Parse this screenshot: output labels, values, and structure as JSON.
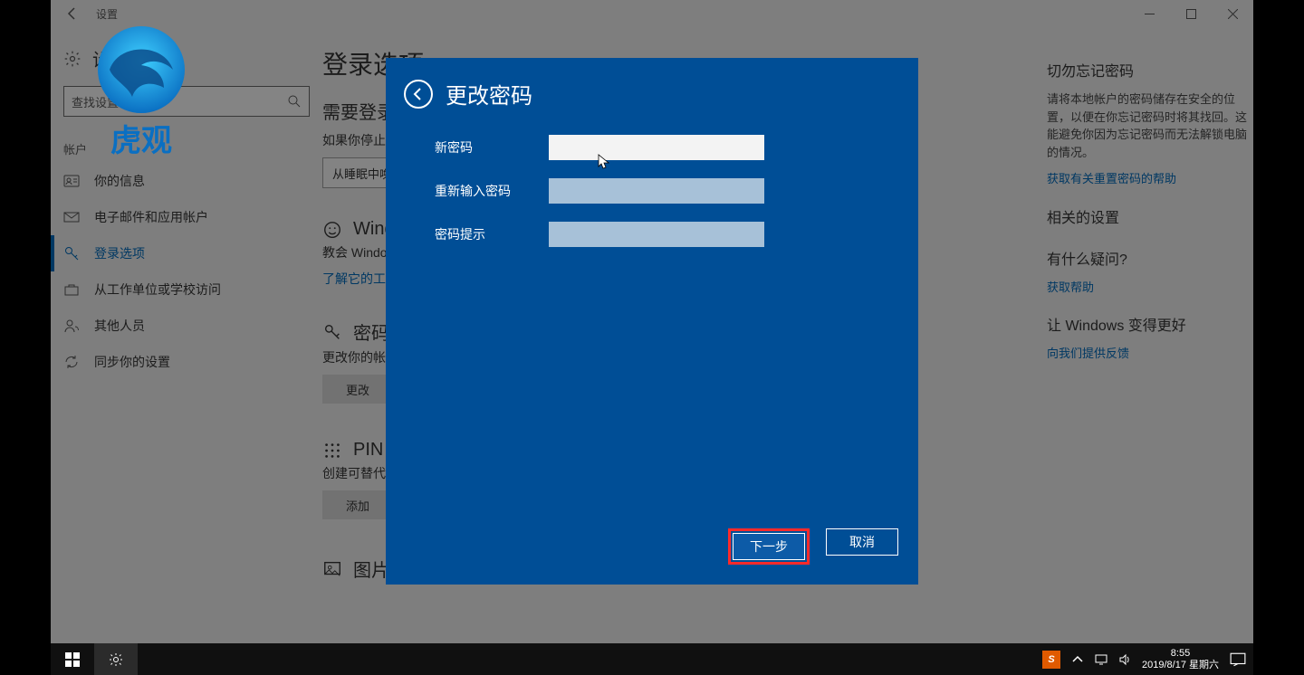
{
  "titlebar": {
    "title": "设置"
  },
  "sidebar": {
    "settings_label": "设置",
    "search_placeholder": "查找设置",
    "section_label": "帐户",
    "items": [
      {
        "label": "你的信息"
      },
      {
        "label": "电子邮件和应用帐户"
      },
      {
        "label": "登录选项"
      },
      {
        "label": "从工作单位或学校访问"
      },
      {
        "label": "其他人员"
      },
      {
        "label": "同步你的设置"
      }
    ]
  },
  "main": {
    "page_title": "登录选项",
    "require_signin": {
      "heading": "需要登录",
      "prompt": "如果你停止使用电脑，Windows 应何时要求你重新登录？",
      "dropdown": "从睡眠中唤醒电脑时"
    },
    "hello": {
      "heading": "Windows Hello",
      "para": "教会 Windows 识别你的面部或指纹，以便你能登录 Windows、应用和服务。",
      "link": "了解它的工作原理"
    },
    "password": {
      "heading": "密码",
      "para": "更改你的帐户密码",
      "button": "更改"
    },
    "pin": {
      "heading": "PIN",
      "para": "创建可替代密码使用的 PIN。当你登录 Windows 时，系统会要求你输入此 PIN。",
      "button": "添加"
    },
    "picpass": {
      "heading": "图片密码"
    }
  },
  "right": {
    "h1": "切勿忘记密码",
    "p1": "请将本地帐户的密码储存在安全的位置，以便在你忘记密码时将其找回。这能避免你因为忘记密码而无法解锁电脑的情况。",
    "l1": "获取有关重置密码的帮助",
    "h2": "相关的设置",
    "h3": "有什么疑问?",
    "l3": "获取帮助",
    "h4": "让 Windows 变得更好",
    "l4": "向我们提供反馈"
  },
  "modal": {
    "title": "更改密码",
    "new_pw": "新密码",
    "re_pw": "重新输入密码",
    "hint": "密码提示",
    "next": "下一步",
    "cancel": "取消"
  },
  "taskbar": {
    "time": "8:55",
    "date": "2019/8/17 星期六",
    "ime": "S"
  },
  "logo_text": "虎观"
}
